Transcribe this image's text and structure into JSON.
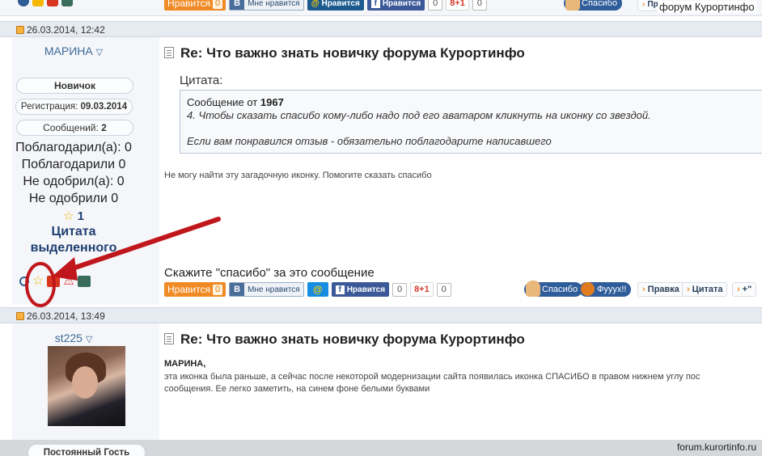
{
  "topbar": {
    "like_label": "Нравится",
    "like_count": "0",
    "vk_label": "Мне нравится",
    "mail_label": "Нравится",
    "fb_label": "Нравится",
    "fb_count": "0",
    "g_label": "8+1",
    "g_count": "0",
    "thanks_label": "Спасибо",
    "right_partial": "Пр",
    "forum_name": "форум Курортинфо"
  },
  "post1": {
    "date": "26.03.2014, 12:42",
    "user": {
      "name": "МАРИНА",
      "rank": "Новичок",
      "registration_label": "Регистрация:",
      "registration_date": "09.03.2014",
      "messages_label": "Сообщений:",
      "messages_count": "2",
      "stats": [
        "Поблагодарил(а): 0",
        "Поблагодарили 0",
        "Не одобрил(а): 0",
        "Не одобрили 0"
      ],
      "star_count": "1",
      "quote_badge": [
        "Цитата",
        "выделенного"
      ]
    },
    "title": "Re: Что важно знать новичку форума Курортинфо",
    "quote": {
      "label": "Цитата:",
      "author_prefix": "Сообщение от",
      "author": "1967",
      "line1": "4. Чтобы сказать спасибо кому-либо надо под его аватаром кликнуть на иконку со звездой.",
      "line2": "Если вам понравился отзыв - обязательно поблагодарите написавшего"
    },
    "body": "Не могу найти эту загадочную иконку. Помогите сказать спасибо",
    "thanks_prompt": "Скажите \"спасибо\" за это сообщение",
    "share": {
      "like_label": "Нравится",
      "like_count": "0",
      "vk_label": "Мне нравится",
      "fb_label": "Нравится",
      "fb_count": "0",
      "g_label": "8+1",
      "g_count": "0"
    },
    "actions": {
      "thanks": "Спасибо",
      "fuu": "Фууух!!",
      "edit": "Правка",
      "quote": "Цитата",
      "plus": "+\""
    }
  },
  "post2": {
    "date": "26.03.2014, 13:49",
    "user": {
      "name": "st225",
      "rank": "Постоянный Гость"
    },
    "title": "Re: Что важно знать новичку форума Курортинфо",
    "mention": "МАРИНА",
    "body_line1": "эта иконка была раньше, а сейчас после некоторой модернизации сайта появилась иконка СПАСИБО в правом нижнем углу пос",
    "body_line2": "сообщения. Ее легко заметить, на синем фоне белыми буквами"
  },
  "footer": {
    "source": "forum.kurortinfo.ru"
  },
  "colors": {
    "annotation": "#c0171d",
    "like": "#f08a24",
    "facebook": "#3b5998",
    "thanks_button": "#2f5d9a",
    "header_band": "#e6ebf2"
  },
  "icons": [
    "search-icon",
    "star-icon",
    "flag-icon",
    "warning-icon",
    "book-icon",
    "document-icon",
    "calendar-icon"
  ]
}
